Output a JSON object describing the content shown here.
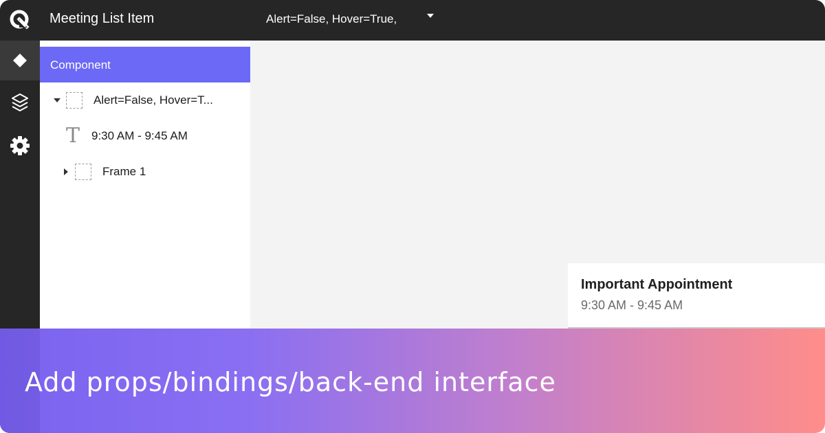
{
  "header": {
    "title": "Meeting List Item",
    "variant_label": "Alert=False, Hover=True,"
  },
  "rail": {
    "items": [
      {
        "icon": "component-diamond-icon",
        "active": true
      },
      {
        "icon": "layers-icon",
        "active": false
      },
      {
        "icon": "settings-gear-icon",
        "active": false
      }
    ]
  },
  "panel": {
    "header": "Component",
    "tree": [
      {
        "label": "Alert=False, Hover=T...",
        "type": "frame",
        "expanded": true
      },
      {
        "label": "9:30 AM - 9:45 AM",
        "type": "text",
        "glyph": "T"
      },
      {
        "label": "Frame 1",
        "type": "frame",
        "expanded": false
      }
    ]
  },
  "canvas": {
    "card": {
      "title": "Important Appointment",
      "time": "9:30 AM - 9:45 AM"
    }
  },
  "banner": {
    "text": "Add props/bindings/back-end interface"
  },
  "colors": {
    "accent": "#6b69f5",
    "dark_chrome": "#262626",
    "gradient_start": "#7a63f0",
    "gradient_end": "#ff8d8a"
  }
}
